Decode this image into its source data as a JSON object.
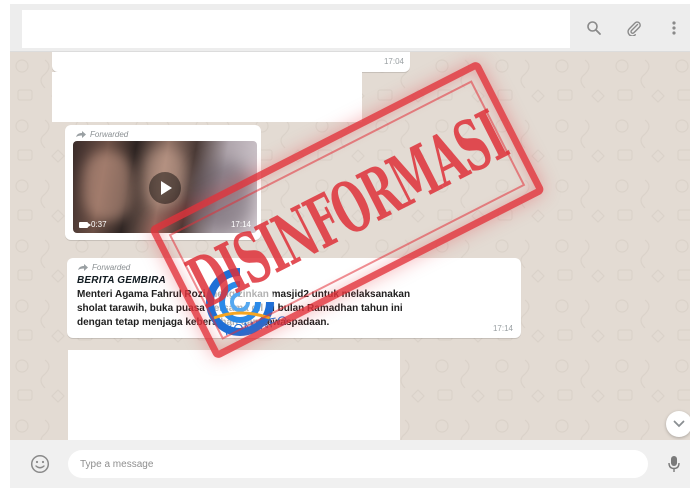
{
  "header": {
    "icons": [
      "search-icon",
      "attach-icon",
      "menu-icon"
    ]
  },
  "messages": [
    {
      "id": "m1",
      "time": "17:04"
    },
    {
      "id": "m2",
      "forwarded_label": "Forwarded",
      "video": {
        "duration": "0:37",
        "time": "17:14"
      }
    },
    {
      "id": "m3",
      "forwarded_label": "Forwarded",
      "title": "BERITA GEMBIRA",
      "body_lines": [
        "Menteri Agama Fahrul Rozi mengizinkan masjid2 untuk melaksanakan",
        "sholat tarawih, buka puasa bersama dll di bulan Ramadhan tahun ini",
        "dengan tetap menjaga kebersihan dan kewaspadaan."
      ],
      "time": "17:14"
    }
  ],
  "overlay": {
    "stamp_text": "DISINFORMASI",
    "logo_text": "KOMINFO",
    "stamp_color": "#e2323a",
    "logo_color": "#1f6fd6"
  },
  "composer": {
    "placeholder": "Type a message",
    "icons": [
      "emoji-icon",
      "mic-icon"
    ]
  },
  "colors": {
    "chat_background": "#e3dbd3",
    "header_background": "#ededed",
    "bubble": "#ffffff"
  }
}
